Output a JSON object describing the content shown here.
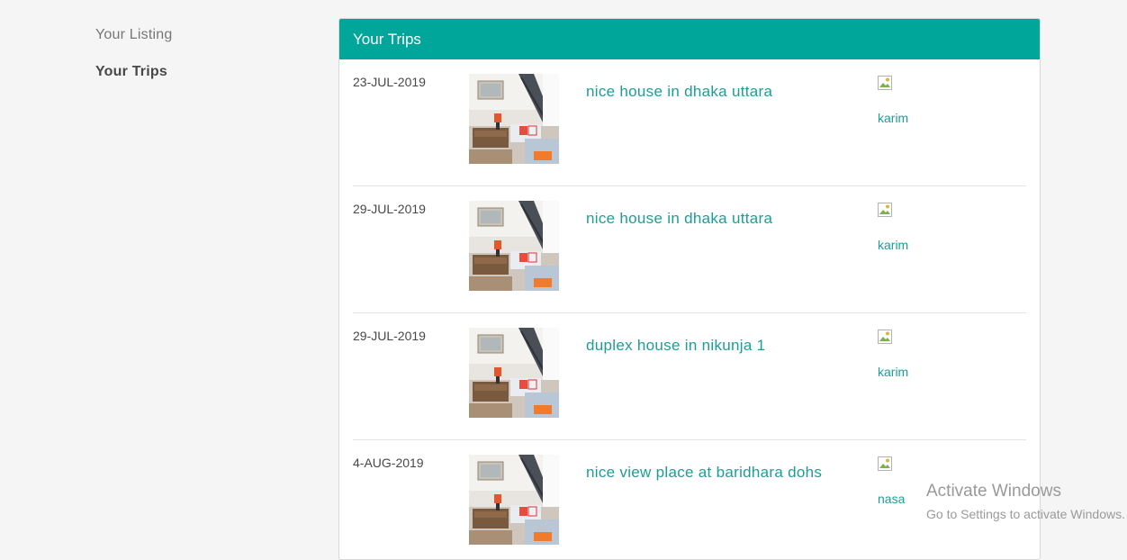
{
  "sidebar": {
    "items": [
      {
        "label": "Your Listing",
        "active": false
      },
      {
        "label": "Your Trips",
        "active": true
      }
    ]
  },
  "panel": {
    "title": "Your Trips",
    "header_color": "#00a699"
  },
  "trips": [
    {
      "date": "23-JUL-2019",
      "title": "nice house in dhaka uttara",
      "host": "karim",
      "image": "room-thumbnail"
    },
    {
      "date": "29-JUL-2019",
      "title": "nice house in dhaka uttara",
      "host": "karim",
      "image": "room-thumbnail"
    },
    {
      "date": "29-JUL-2019",
      "title": "duplex house in nikunja 1",
      "host": "karim",
      "image": "room-thumbnail"
    },
    {
      "date": "4-AUG-2019",
      "title": "nice view place at baridhara dohs",
      "host": "nasa",
      "image": "room-thumbnail"
    }
  ],
  "watermark": {
    "line1": "Activate Windows",
    "line2": "Go to Settings to activate Windows."
  },
  "colors": {
    "accent": "#00a699",
    "link": "#1b9f94",
    "background": "#f5f5f5"
  }
}
